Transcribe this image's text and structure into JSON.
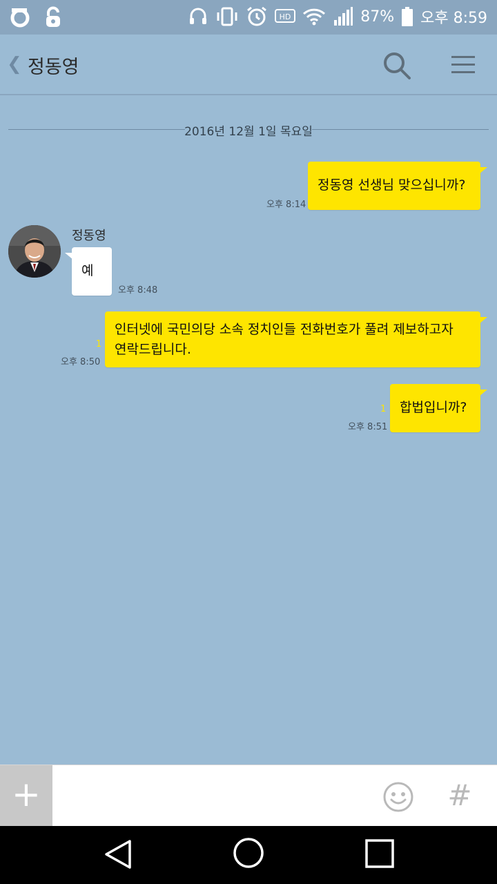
{
  "status_bar": {
    "battery": "87%",
    "time": "오후 8:59",
    "icons": [
      "o-app-icon",
      "lock-app-icon",
      "headset-icon",
      "vibrate-icon",
      "alarm-icon",
      "hd-icon",
      "wifi-icon",
      "signal-icon",
      "battery-icon"
    ]
  },
  "header": {
    "back_label": "❮",
    "title": "정동영",
    "icons": [
      "search-icon",
      "menu-icon"
    ]
  },
  "chat": {
    "date": "2016년 12월 1일 목요일",
    "sender_name": "정동영",
    "messages": [
      {
        "dir": "out",
        "text": "정동영 선생님 맞으십니까?",
        "time": "오후 8:14",
        "unread": ""
      },
      {
        "dir": "in",
        "text": "예",
        "time": "오후 8:48",
        "unread": ""
      },
      {
        "dir": "out",
        "line1": "인터넷에 국민의당 소속 정치인들 전화번호가 풀려 제보하고자",
        "line2": "연락드립니다.",
        "time": "오후 8:50",
        "unread": "1"
      },
      {
        "dir": "out",
        "text": "합법입니까?",
        "time": "오후 8:51",
        "unread": "1"
      }
    ]
  },
  "input_bar": {
    "plus_label": "+",
    "placeholder": "",
    "hash_label": "#"
  },
  "colors": {
    "background": "#9bbbd4",
    "my_bubble": "#fee500",
    "their_bubble": "#ffffff",
    "status_bar": "#8aa6bf"
  }
}
